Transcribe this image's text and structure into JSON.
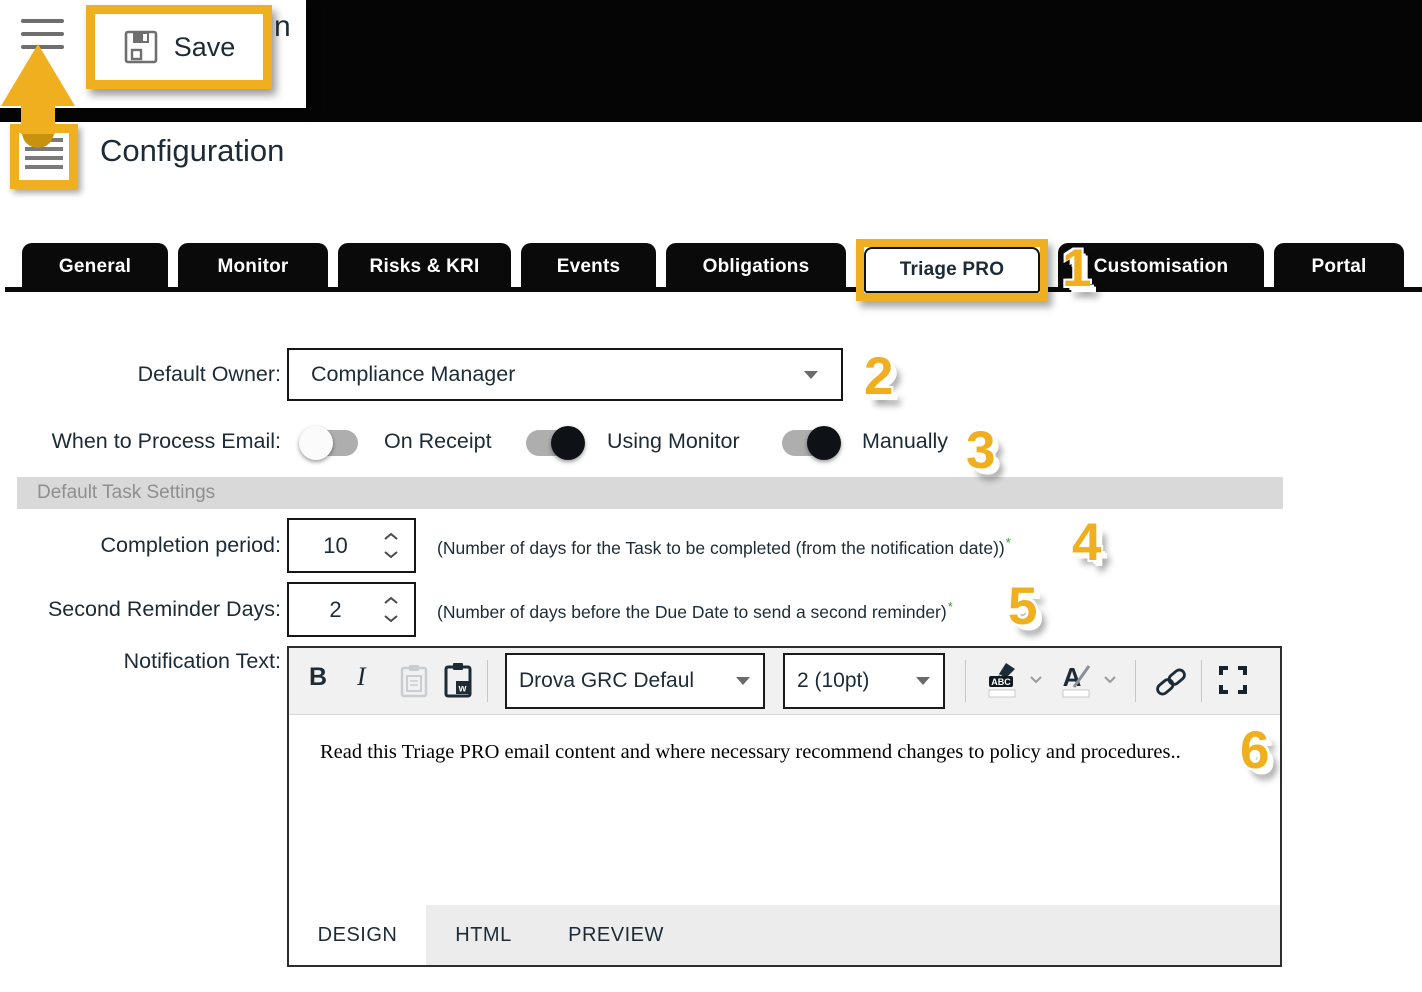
{
  "colors": {
    "accent_gold": "#F0AF1E",
    "arrow_cap_gold": "#C8920E",
    "text_navy": "#1C2B36",
    "tab_black": "#0A0A0A",
    "section_bar_gray": "#D9D9D9",
    "toolbar_gray": "#F1F1F1",
    "required_green": "#2E9E1F"
  },
  "callout": {
    "save_label": "Save",
    "clipped_text": "n"
  },
  "page": {
    "title": "Configuration"
  },
  "tabs": [
    {
      "label": "General"
    },
    {
      "label": "Monitor"
    },
    {
      "label": "Risks & KRI"
    },
    {
      "label": "Events"
    },
    {
      "label": "Obligations"
    },
    {
      "label": "Triage PRO"
    },
    {
      "label": "Customisation"
    },
    {
      "label": "Portal"
    }
  ],
  "step_badges": [
    "1",
    "2",
    "3",
    "4",
    "5",
    "6"
  ],
  "form": {
    "default_owner": {
      "label": "Default Owner:",
      "value": "Compliance Manager"
    },
    "process_email": {
      "label": "When to Process Email:",
      "options": [
        {
          "label": "On Receipt",
          "state": "off"
        },
        {
          "label": "Using Monitor",
          "state": "on"
        },
        {
          "label": "Manually",
          "state": "on"
        }
      ]
    },
    "task_settings_header": "Default Task Settings",
    "completion_period": {
      "label": "Completion period:",
      "value": "10",
      "hint": "(Number of days for the Task to be completed (from the notification date))",
      "required_mark": "*"
    },
    "second_reminder": {
      "label": "Second Reminder Days:",
      "value": "2",
      "hint": "(Number of days before the Due Date to send a second reminder)",
      "required_mark": "*"
    },
    "notification": {
      "label": "Notification Text:",
      "toolbar": {
        "bold": "B",
        "italic": "I",
        "font_name": "Drova GRC Defaul",
        "font_size": "2 (10pt)"
      },
      "content": "Read this Triage PRO email content and where necessary recommend changes to policy and procedures..",
      "modes": [
        {
          "label": "DESIGN"
        },
        {
          "label": "HTML"
        },
        {
          "label": "PREVIEW"
        }
      ]
    }
  },
  "icons": {
    "hamburger": "three horizontal bars",
    "save": "floppy-disk",
    "paste": "clipboard (disabled gray)",
    "paste-word": "clipboard with W",
    "spellcheck-color": "pen over ABC with white swatch",
    "font-color": "letter A with pen and white swatch",
    "link": "chain links",
    "fullscreen": "corner brackets",
    "chevron-down": "v caret",
    "spinner-up": "up chevron",
    "spinner-down": "down chevron",
    "dropdown-caret": "solid down triangle"
  }
}
